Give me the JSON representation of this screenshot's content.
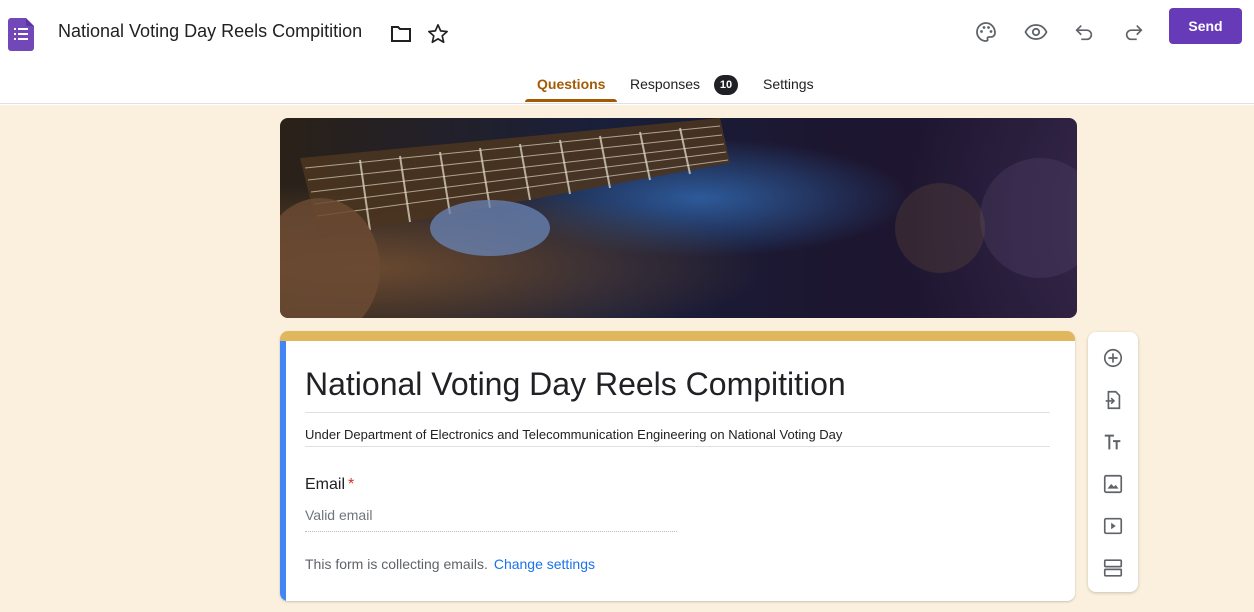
{
  "header": {
    "doc_title": "National Voting Day Reels Compitition",
    "send_label": "Send",
    "icons": [
      "folder-icon",
      "star-icon",
      "palette-icon",
      "preview-icon",
      "undo-icon",
      "redo-icon"
    ]
  },
  "tabs": {
    "questions": "Questions",
    "responses": "Responses",
    "responses_count": "10",
    "settings": "Settings"
  },
  "colors": {
    "accent": "#673ab7",
    "tab_active": "#a35a06",
    "background": "#faf0dd",
    "card_top": "#e0b75c",
    "card_left": "#4285f4"
  },
  "form": {
    "title": "National Voting Day Reels Compitition",
    "description": "Under Department of Electronics and Telecommunication Engineering on National Voting Day",
    "question_label": "Email",
    "required_mark": "*",
    "input_placeholder": "Valid email",
    "note_text": "This form is collecting emails.",
    "note_link": "Change settings"
  },
  "toolbar": {
    "items": [
      "add-question-icon",
      "import-questions-icon",
      "add-title-icon",
      "add-image-icon",
      "add-video-icon",
      "add-section-icon"
    ]
  }
}
